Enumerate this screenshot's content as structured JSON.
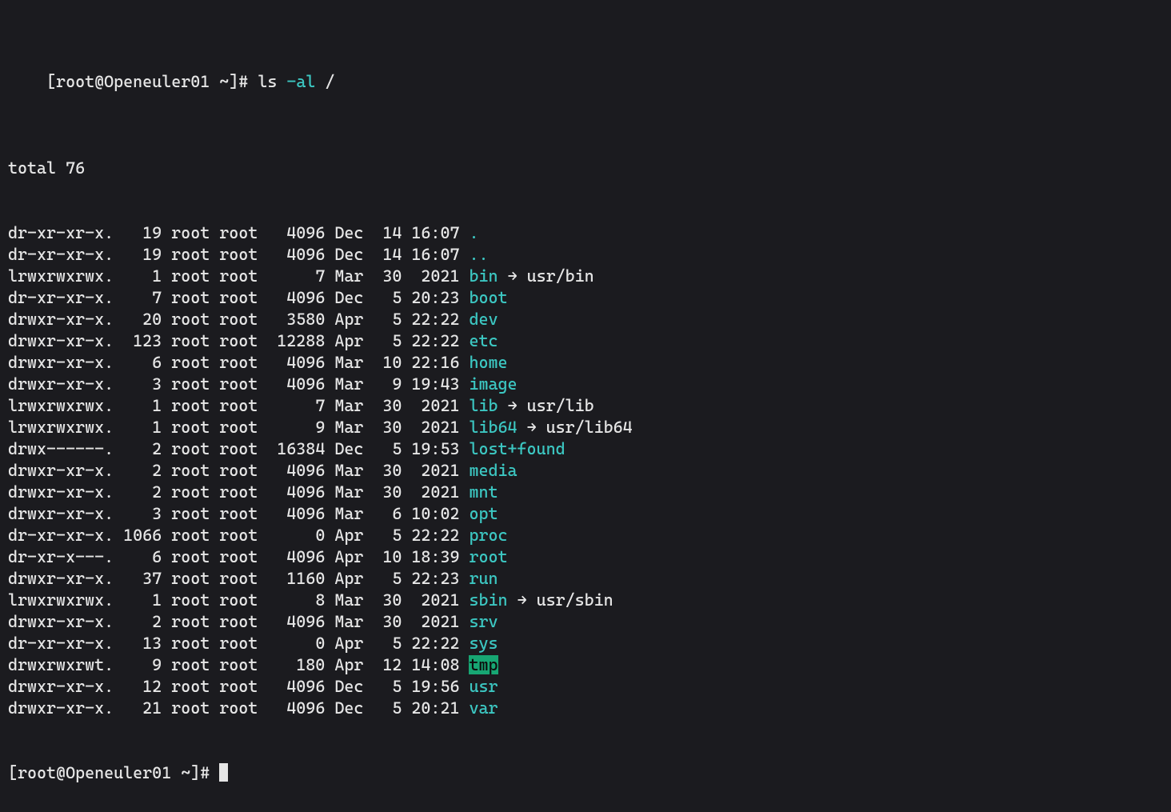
{
  "prompt": {
    "prefix": "[root@Openeuler01 ~]#",
    "command_plain": "ls",
    "command_flag": "-al",
    "command_arg": "/"
  },
  "total_line": "total 76",
  "rows": [
    {
      "perms": "dr-xr-xr-x.",
      "links": "19",
      "owner": "root",
      "group": "root",
      "size": "4096",
      "month": "Dec",
      "day": "14",
      "time": "16:07",
      "name": ".",
      "name_class": "fg-cyan",
      "link_target": ""
    },
    {
      "perms": "dr-xr-xr-x.",
      "links": "19",
      "owner": "root",
      "group": "root",
      "size": "4096",
      "month": "Dec",
      "day": "14",
      "time": "16:07",
      "name": "..",
      "name_class": "fg-cyan",
      "link_target": ""
    },
    {
      "perms": "lrwxrwxrwx.",
      "links": "1",
      "owner": "root",
      "group": "root",
      "size": "7",
      "month": "Mar",
      "day": "30",
      "time": "2021",
      "name": "bin",
      "name_class": "fg-cyan",
      "link_target": "usr/bin"
    },
    {
      "perms": "dr-xr-xr-x.",
      "links": "7",
      "owner": "root",
      "group": "root",
      "size": "4096",
      "month": "Dec",
      "day": "5",
      "time": "20:23",
      "name": "boot",
      "name_class": "fg-cyan",
      "link_target": ""
    },
    {
      "perms": "drwxr-xr-x.",
      "links": "20",
      "owner": "root",
      "group": "root",
      "size": "3580",
      "month": "Apr",
      "day": "5",
      "time": "22:22",
      "name": "dev",
      "name_class": "fg-cyan",
      "link_target": ""
    },
    {
      "perms": "drwxr-xr-x.",
      "links": "123",
      "owner": "root",
      "group": "root",
      "size": "12288",
      "month": "Apr",
      "day": "5",
      "time": "22:22",
      "name": "etc",
      "name_class": "fg-cyan",
      "link_target": ""
    },
    {
      "perms": "drwxr-xr-x.",
      "links": "6",
      "owner": "root",
      "group": "root",
      "size": "4096",
      "month": "Mar",
      "day": "10",
      "time": "22:16",
      "name": "home",
      "name_class": "fg-cyan",
      "link_target": ""
    },
    {
      "perms": "drwxr-xr-x.",
      "links": "3",
      "owner": "root",
      "group": "root",
      "size": "4096",
      "month": "Mar",
      "day": "9",
      "time": "19:43",
      "name": "image",
      "name_class": "fg-cyan",
      "link_target": ""
    },
    {
      "perms": "lrwxrwxrwx.",
      "links": "1",
      "owner": "root",
      "group": "root",
      "size": "7",
      "month": "Mar",
      "day": "30",
      "time": "2021",
      "name": "lib",
      "name_class": "fg-cyan",
      "link_target": "usr/lib"
    },
    {
      "perms": "lrwxrwxrwx.",
      "links": "1",
      "owner": "root",
      "group": "root",
      "size": "9",
      "month": "Mar",
      "day": "30",
      "time": "2021",
      "name": "lib64",
      "name_class": "fg-cyan",
      "link_target": "usr/lib64"
    },
    {
      "perms": "drwx------.",
      "links": "2",
      "owner": "root",
      "group": "root",
      "size": "16384",
      "month": "Dec",
      "day": "5",
      "time": "19:53",
      "name": "lost+found",
      "name_class": "fg-cyan",
      "link_target": ""
    },
    {
      "perms": "drwxr-xr-x.",
      "links": "2",
      "owner": "root",
      "group": "root",
      "size": "4096",
      "month": "Mar",
      "day": "30",
      "time": "2021",
      "name": "media",
      "name_class": "fg-cyan",
      "link_target": ""
    },
    {
      "perms": "drwxr-xr-x.",
      "links": "2",
      "owner": "root",
      "group": "root",
      "size": "4096",
      "month": "Mar",
      "day": "30",
      "time": "2021",
      "name": "mnt",
      "name_class": "fg-cyan",
      "link_target": ""
    },
    {
      "perms": "drwxr-xr-x.",
      "links": "3",
      "owner": "root",
      "group": "root",
      "size": "4096",
      "month": "Mar",
      "day": "6",
      "time": "10:02",
      "name": "opt",
      "name_class": "fg-cyan",
      "link_target": ""
    },
    {
      "perms": "dr-xr-xr-x.",
      "links": "1066",
      "owner": "root",
      "group": "root",
      "size": "0",
      "month": "Apr",
      "day": "5",
      "time": "22:22",
      "name": "proc",
      "name_class": "fg-cyan",
      "link_target": ""
    },
    {
      "perms": "dr-xr-x---.",
      "links": "6",
      "owner": "root",
      "group": "root",
      "size": "4096",
      "month": "Apr",
      "day": "10",
      "time": "18:39",
      "name": "root",
      "name_class": "fg-cyan",
      "link_target": ""
    },
    {
      "perms": "drwxr-xr-x.",
      "links": "37",
      "owner": "root",
      "group": "root",
      "size": "1160",
      "month": "Apr",
      "day": "5",
      "time": "22:23",
      "name": "run",
      "name_class": "fg-cyan",
      "link_target": ""
    },
    {
      "perms": "lrwxrwxrwx.",
      "links": "1",
      "owner": "root",
      "group": "root",
      "size": "8",
      "month": "Mar",
      "day": "30",
      "time": "2021",
      "name": "sbin",
      "name_class": "fg-cyan",
      "link_target": "usr/sbin"
    },
    {
      "perms": "drwxr-xr-x.",
      "links": "2",
      "owner": "root",
      "group": "root",
      "size": "4096",
      "month": "Mar",
      "day": "30",
      "time": "2021",
      "name": "srv",
      "name_class": "fg-cyan",
      "link_target": ""
    },
    {
      "perms": "dr-xr-xr-x.",
      "links": "13",
      "owner": "root",
      "group": "root",
      "size": "0",
      "month": "Apr",
      "day": "5",
      "time": "22:22",
      "name": "sys",
      "name_class": "fg-cyan",
      "link_target": ""
    },
    {
      "perms": "drwxrwxrwt.",
      "links": "9",
      "owner": "root",
      "group": "root",
      "size": "180",
      "month": "Apr",
      "day": "12",
      "time": "14:08",
      "name": "tmp",
      "name_class": "tmp-hl",
      "link_target": ""
    },
    {
      "perms": "drwxr-xr-x.",
      "links": "12",
      "owner": "root",
      "group": "root",
      "size": "4096",
      "month": "Dec",
      "day": "5",
      "time": "19:56",
      "name": "usr",
      "name_class": "fg-cyan",
      "link_target": ""
    },
    {
      "perms": "drwxr-xr-x.",
      "links": "21",
      "owner": "root",
      "group": "root",
      "size": "4096",
      "month": "Dec",
      "day": "5",
      "time": "20:21",
      "name": "var",
      "name_class": "fg-cyan",
      "link_target": ""
    }
  ],
  "next_prompt": "[root@Openeuler01 ~]#",
  "arrow": " → "
}
